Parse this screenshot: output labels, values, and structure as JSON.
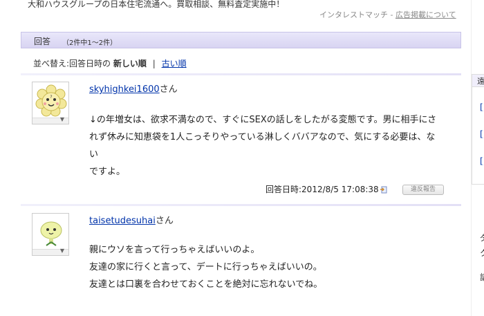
{
  "ad": {
    "text": "大和ハウスグループの日本住宅流通へ。買取相談、無料査定実施中！",
    "credit_prefix": "インタレストマッチ - ",
    "credit_link": "広告掲載について"
  },
  "answers_header": {
    "title": "回答",
    "count": "（2件中1〜2件）"
  },
  "sort": {
    "label": "並べ替え:回答日時の",
    "newest": "新しい順",
    "separator": "|",
    "oldest": "古い順"
  },
  "answers": [
    {
      "username": "skyhighkei1600",
      "suffix": "さん",
      "lines": [
        "↓の年増女は、欲求不満なので、すぐにSEXの話しをしたがる変態です。男に相手にさ",
        "れず休みに知恵袋を1人こっそりやっている淋しくババアなので、気にする必要は、ない",
        "ですよ。"
      ],
      "meta_label": "回答日時:",
      "datetime": "2012/8/5 17:08:38",
      "report_label": "違反報告"
    },
    {
      "username": "taisetudesuhai",
      "suffix": "さん",
      "lines": [
        "親にウソを言って行っちゃえばいいのよ。",
        "友達の家に行くと言って、デートに行っちゃえばいいの。",
        "友達とは口裏を合わせておくことを絶対に忘れないでね。"
      ]
    }
  ],
  "sidebar": {
    "header_char": "遠",
    "links": [
      "[",
      "[",
      "["
    ],
    "fragments": [
      "ダ",
      "ク",
      "講"
    ]
  },
  "colors": {
    "link": "#0033aa",
    "header_bar": "#dcd8f3"
  }
}
